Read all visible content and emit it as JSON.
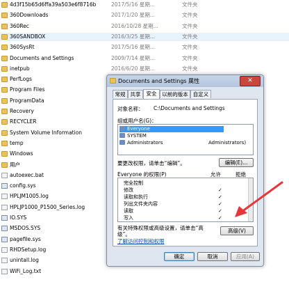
{
  "files": [
    {
      "name": "4d3f15b65d6ffa39a503e6f8716b",
      "date": "2017/5/16 星期...",
      "type": "文件夹",
      "icon": "folder"
    },
    {
      "name": "360Downloads",
      "date": "2017/1/20 星期...",
      "type": "文件夹",
      "icon": "folder"
    },
    {
      "name": "360Rec",
      "date": "2016/10/28 星期...",
      "type": "文件夹",
      "icon": "folder"
    },
    {
      "name": "360SANDBOX",
      "date": "2016/3/25 星期...",
      "type": "文件夹",
      "icon": "folder"
    },
    {
      "name": "360SysRt",
      "date": "2017/5/16 星期...",
      "type": "文件夹",
      "icon": "folder"
    },
    {
      "name": "Documents and Settings",
      "date": "2009/7/14 星期...",
      "type": "文件夹",
      "icon": "folder"
    },
    {
      "name": "inetpub",
      "date": "2016/6/20 星期...",
      "type": "文件夹",
      "icon": "folder"
    },
    {
      "name": "PerfLogs",
      "date": "",
      "type": "",
      "icon": "folder"
    },
    {
      "name": "Program Files",
      "date": "",
      "type": "",
      "icon": "folder"
    },
    {
      "name": "ProgramData",
      "date": "",
      "type": "",
      "icon": "folder"
    },
    {
      "name": "Recovery",
      "date": "",
      "type": "",
      "icon": "folder"
    },
    {
      "name": "RECYCLER",
      "date": "",
      "type": "",
      "icon": "folder"
    },
    {
      "name": "System Volume Information",
      "date": "",
      "type": "",
      "icon": "folder"
    },
    {
      "name": "temp",
      "date": "",
      "type": "",
      "icon": "folder"
    },
    {
      "name": "Windows",
      "date": "",
      "type": "",
      "icon": "folder"
    },
    {
      "name": "用户",
      "date": "",
      "type": "",
      "icon": "folder"
    },
    {
      "name": "autoexec.bat",
      "date": "",
      "type": "",
      "icon": "file"
    },
    {
      "name": "config.sys",
      "date": "",
      "type": "",
      "icon": "sys"
    },
    {
      "name": "HPLJM1005.log",
      "date": "",
      "type": "",
      "icon": "file"
    },
    {
      "name": "HPLJP1000_P1500_Series.log",
      "date": "",
      "type": "",
      "icon": "file"
    },
    {
      "name": "IO.SYS",
      "date": "",
      "type": "",
      "icon": "sys"
    },
    {
      "name": "MSDOS.SYS",
      "date": "",
      "type": "",
      "icon": "sys"
    },
    {
      "name": "pagefile.sys",
      "date": "",
      "type": "",
      "icon": "sys"
    },
    {
      "name": "RHDSetup.log",
      "date": "",
      "type": "",
      "icon": "file"
    },
    {
      "name": "unintall.log",
      "date": "",
      "type": "",
      "icon": "file"
    },
    {
      "name": "WiFi_Log.txt",
      "date": "",
      "type": "",
      "icon": "file"
    }
  ],
  "dialog": {
    "title": "Documents and Settings 属性",
    "close_label": "✕",
    "tabs": [
      "常规",
      "共享",
      "安全",
      "以前的版本",
      "自定义"
    ],
    "object_name_label": "对象名称：",
    "object_name_value": "C:\\Documents and Settings",
    "group_label": "组或用户名(G)：",
    "users": [
      {
        "name": "Everyone",
        "extra": ""
      },
      {
        "name": "SYSTEM",
        "extra": ""
      },
      {
        "name": "Administrators",
        "extra": "Administrators)"
      }
    ],
    "change_hint": "要更改权限，请单击“编辑”。",
    "edit_button": "编辑(E)...",
    "perm_header": "Everyone 的权限(P)",
    "allow_label": "允许",
    "deny_label": "拒绝",
    "permissions": [
      {
        "name": "完全控制",
        "allow": ""
      },
      {
        "name": "修改",
        "allow": "✓"
      },
      {
        "name": "读取和执行",
        "allow": "✓"
      },
      {
        "name": "列出文件夹内容",
        "allow": "✓"
      },
      {
        "name": "读取",
        "allow": "✓"
      },
      {
        "name": "写入",
        "allow": "✓"
      }
    ],
    "advanced_hint": "有关特殊权限或高级设置，请单击“高级”。",
    "advanced_button": "高级(V)",
    "learn_link": "了解访问控制和权限",
    "ok_button": "确定",
    "cancel_button": "取消",
    "apply_button": "应用(A)"
  },
  "colors": {
    "arrow": "#e5373a",
    "selection": "#3399ff"
  }
}
